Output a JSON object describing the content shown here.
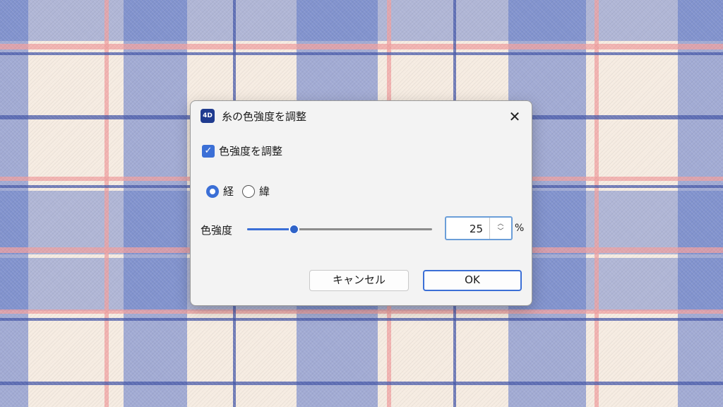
{
  "dialog": {
    "title": "糸の色強度を調整",
    "app_icon_text": "4D",
    "close_glyph": "✕",
    "checkbox": {
      "label": "色強度を調整",
      "checked": true,
      "check_glyph": "✓"
    },
    "radios": [
      {
        "label": "経",
        "checked": true
      },
      {
        "label": "緯",
        "checked": false
      }
    ],
    "intensity": {
      "label": "色強度",
      "value": "25",
      "unit": "%",
      "slider_fraction": 0.25,
      "up_glyph": "︿",
      "down_glyph": "﹀"
    },
    "buttons": {
      "cancel": "キャンセル",
      "ok": "OK"
    }
  },
  "colors": {
    "accent": "#3b6fd6",
    "plaid_blue": "#5c76c8",
    "plaid_pink": "#f0a0a0",
    "plaid_cream": "#f6ece2"
  }
}
